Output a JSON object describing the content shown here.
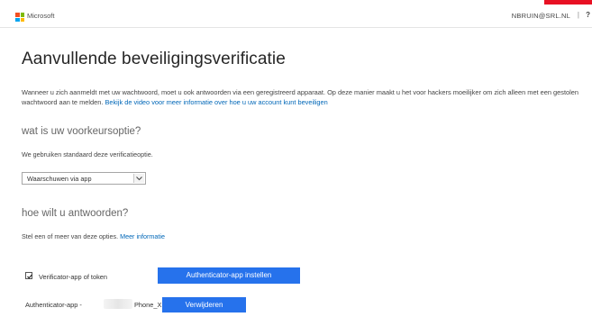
{
  "header": {
    "brand": "Microsoft",
    "account": "NBRUIN@SRL.NL",
    "separator": "|",
    "help": "?"
  },
  "page": {
    "title": "Aanvullende beveiligingsverificatie",
    "intro_text": "Wanneer u zich aanmeldt met uw wachtwoord, moet u ook antwoorden via een geregistreerd apparaat. Op deze manier maakt u het voor hackers moeilijker om zich alleen met een gestolen wachtwoord aan te melden. ",
    "intro_link": "Bekijk de video voor meer informatie over hoe u uw account kunt beveiligen"
  },
  "preferred_option": {
    "heading": "wat is uw voorkeursoptie?",
    "note": "We gebruiken standaard deze verificatieoptie.",
    "selected": "Waarschuwen via app"
  },
  "response_methods": {
    "heading": "hoe wilt u antwoorden?",
    "note": "Stel een of meer van deze opties. ",
    "note_link": "Meer informatie",
    "option_label": "Verificator-app of token",
    "option_checked": true,
    "setup_button": "Authenticator-app instellen",
    "device_prefix": "Authenticator-app -",
    "device_suffix": "Phone_XR",
    "remove_button": "Verwijderen"
  },
  "colors": {
    "accent": "#2672ec",
    "link": "#0067b8",
    "top_red": "#e81123"
  }
}
